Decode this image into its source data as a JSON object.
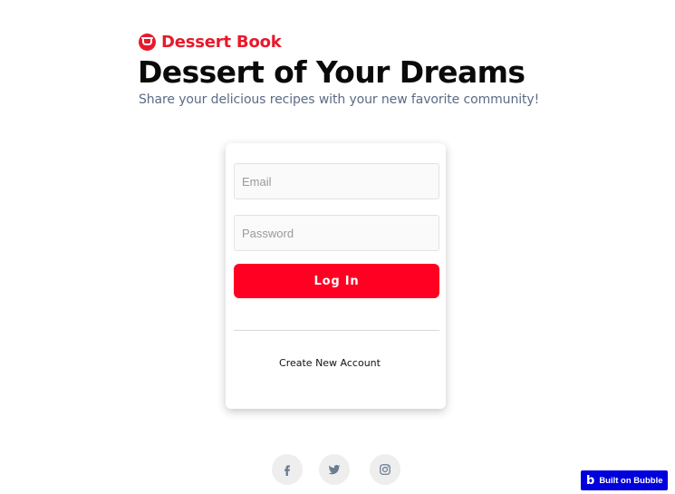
{
  "brand": {
    "name": "Dessert Book",
    "icon": "cupcake-icon",
    "color": "#e8192c"
  },
  "hero": {
    "title": "Dessert of Your Dreams",
    "subtitle": "Share your delicious recipes with your new favorite community!"
  },
  "login_form": {
    "email_placeholder": "Email",
    "password_placeholder": "Password",
    "login_label": "Log In",
    "create_account_label": "Create New Account",
    "button_color": "#ff0022"
  },
  "social": {
    "icons": [
      "facebook-icon",
      "twitter-icon",
      "instagram-icon"
    ],
    "icon_color": "#6b7c93"
  },
  "badge": {
    "label": "Built on Bubble",
    "color": "#0000dd"
  }
}
